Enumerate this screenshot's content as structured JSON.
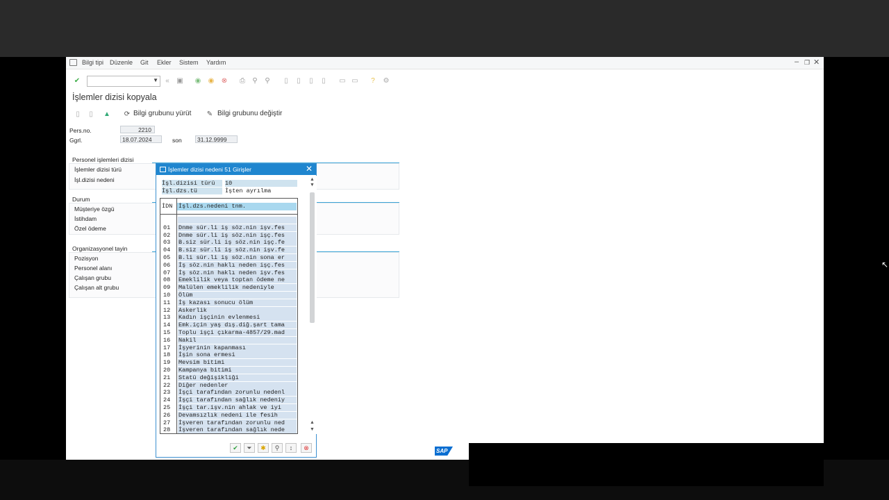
{
  "menubar": {
    "items": [
      "Bilgi tipi",
      "Düzenle",
      "Git",
      "Ekler",
      "Sistem",
      "Yardım"
    ]
  },
  "page": {
    "title": "İşlemler dizisi kopyala"
  },
  "app_toolbar": {
    "execute_label": "Bilgi grubunu yürüt",
    "change_label": "Bilgi grubunu değiştir"
  },
  "header": {
    "persno_label": "Pers.no.",
    "persno_value": "2210",
    "valid_label": "Ggrl.",
    "valid_from": "18.07.2024",
    "to_label": "son",
    "valid_to": "31.12.9999"
  },
  "groups": {
    "actions": {
      "title": "Personel işlemleri dizisi",
      "fields": [
        "İşlemler dizisi türü",
        "İşl.dizisi nedeni"
      ]
    },
    "status": {
      "title": "Durum",
      "fields": [
        "Müşteriye özgü",
        "İstihdam",
        "Özel ödeme"
      ]
    },
    "org": {
      "title": "Organizasyonel tayin",
      "fields": [
        "Pozisyon",
        "Personel alanı",
        "Çalışan grubu",
        "Çalışan alt grubu"
      ]
    }
  },
  "dialog": {
    "title": "İşlemler dizisi nedeni 51 Girişler",
    "hdr_type_label": "İşl.dizisi türü",
    "hdr_type_value": "10",
    "hdr_text_label": "İşl.dzs.tü",
    "hdr_text_value": "İşten ayrılma",
    "col_key": "İDN",
    "col_text": "İşl.dzs.nedeni tnm.",
    "rows": [
      {
        "k": "",
        "v": ""
      },
      {
        "k": "01",
        "v": "Dnme sür.li iş söz.nin işv.fes"
      },
      {
        "k": "02",
        "v": "Dnme sür.li iş söz.nin işç.fes"
      },
      {
        "k": "03",
        "v": "B.siz sür.li iş söz.nin işç.fe"
      },
      {
        "k": "04",
        "v": "B.siz sür.li iş söz.nin işv.fe"
      },
      {
        "k": "05",
        "v": "B.li sür.li iş söz.nin sona er"
      },
      {
        "k": "06",
        "v": "İş söz.nin haklı neden işç.fes"
      },
      {
        "k": "07",
        "v": "İş söz.nin haklı neden işv.fes"
      },
      {
        "k": "08",
        "v": "Emeklilik veya toptan ödeme ne"
      },
      {
        "k": "09",
        "v": "Malülen emeklilik nedeniyle"
      },
      {
        "k": "10",
        "v": "Ölüm"
      },
      {
        "k": "11",
        "v": "İş kazası sonucu ölüm"
      },
      {
        "k": "12",
        "v": "Askerlik"
      },
      {
        "k": "13",
        "v": "Kadın işçinin evlenmesi"
      },
      {
        "k": "14",
        "v": "Emk.için yaş dış.diğ.şart tama"
      },
      {
        "k": "15",
        "v": "Toplu işçi çıkarma-4857/29.mad"
      },
      {
        "k": "16",
        "v": "Nakil"
      },
      {
        "k": "17",
        "v": "İşyerinin kapanması"
      },
      {
        "k": "18",
        "v": "İşin sona ermesi"
      },
      {
        "k": "19",
        "v": "Mevsim bitimi"
      },
      {
        "k": "20",
        "v": "Kampanya bitimi"
      },
      {
        "k": "21",
        "v": "Statü değişikliği"
      },
      {
        "k": "22",
        "v": "Diğer nedenler"
      },
      {
        "k": "23",
        "v": "İşçi tarafından zorunlu nedenl"
      },
      {
        "k": "24",
        "v": "İşçi tarafından sağlık nedeniy"
      },
      {
        "k": "25",
        "v": "İşçi tar.işv.nin ahlak ve iyi"
      },
      {
        "k": "26",
        "v": "Devamsızlık nedeni ile fesih"
      },
      {
        "k": "27",
        "v": "İşveren tarafından zorunlu ned"
      },
      {
        "k": "28",
        "v": "İşveren tarafından sağlık nede"
      }
    ]
  },
  "footer": {
    "logo": "SAP"
  },
  "colors": {
    "accent": "#1f86cf",
    "row_bg": "#d5e2f0",
    "header_bg": "#a9d8ef",
    "group_line": "#3aa3d6"
  },
  "icons": [
    "check-icon",
    "back-icon",
    "save-icon",
    "cancel-icon",
    "print-icon",
    "find-icon",
    "help-icon",
    "settings-icon",
    "filter-icon",
    "close-icon"
  ]
}
